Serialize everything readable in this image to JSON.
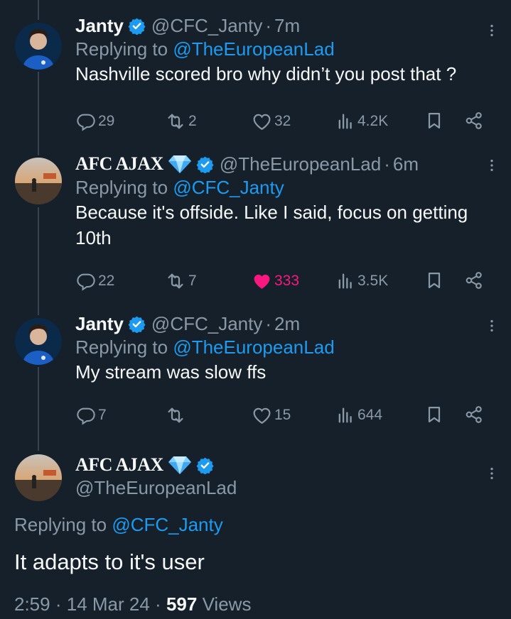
{
  "tweets": [
    {
      "name": "Janty",
      "handle": "@CFC_Janty",
      "time": "7m",
      "replying_prefix": "Replying to",
      "replying_to": "@TheEuropeanLad",
      "text": "Nashville scored bro why didn’t you post that ?",
      "replies": "29",
      "retweets": "2",
      "likes": "32",
      "views": "4.2K",
      "liked": false
    },
    {
      "name": "AFC AJAX",
      "handle": "@TheEuropeanLad",
      "time": "6m",
      "replying_prefix": "Replying to",
      "replying_to": "@CFC_Janty",
      "text": "Because it's offside. Like I said, focus on getting 10th",
      "replies": "22",
      "retweets": "7",
      "likes": "333",
      "views": "3.5K",
      "liked": true
    },
    {
      "name": "Janty",
      "handle": "@CFC_Janty",
      "time": "2m",
      "replying_prefix": "Replying to",
      "replying_to": "@TheEuropeanLad",
      "text": "My stream was slow ffs",
      "replies": "7",
      "retweets": "",
      "likes": "15",
      "views": "644",
      "liked": false
    }
  ],
  "main": {
    "name": "AFC AJAX",
    "handle": "@TheEuropeanLad",
    "replying_prefix": "Replying to",
    "replying_to": "@CFC_Janty",
    "text": "It adapts to it's user",
    "time": "2:59",
    "date": "14 Mar 24",
    "views_count": "597",
    "views_label": "Views"
  },
  "colors": {
    "background": "#15202b",
    "muted": "#8b98a5",
    "link": "#1d9bf0",
    "like": "#f91880",
    "text": "#f7f9f9"
  },
  "icons": [
    "reply-icon",
    "retweet-icon",
    "heart-icon",
    "views-icon",
    "bookmark-icon",
    "share-icon",
    "more-icon",
    "verified-icon",
    "diamond-icon"
  ]
}
